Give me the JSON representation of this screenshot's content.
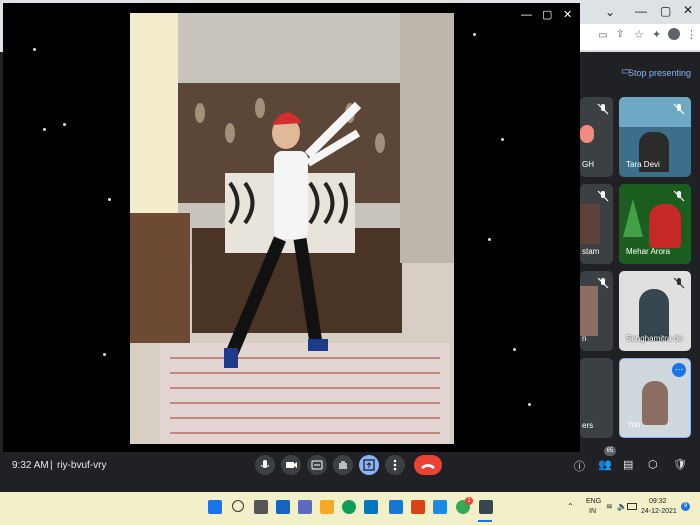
{
  "meet": {
    "stop_presenting": "Stop presenting",
    "participants_count": "65",
    "time": "9:32 AM",
    "meeting_code": "riy-bvuf-vry",
    "tiles": [
      {
        "name": "Tara Devi"
      },
      {
        "name": "Mehar Arora"
      },
      {
        "name": "Sanghamitra de"
      },
      {
        "name": "You"
      }
    ],
    "partial_names": [
      "GH",
      "stam",
      "n",
      "ers"
    ]
  },
  "taskbar": {
    "lang": "ENG",
    "region": "IN",
    "clock_time": "09:32",
    "clock_date": "24-12-2021",
    "notification_count": "9",
    "chrome_badge": "1"
  },
  "colors": {
    "end_call": "#ea4335",
    "present_active": "#8ab4f8",
    "taskbar": "#f1f0c8"
  }
}
